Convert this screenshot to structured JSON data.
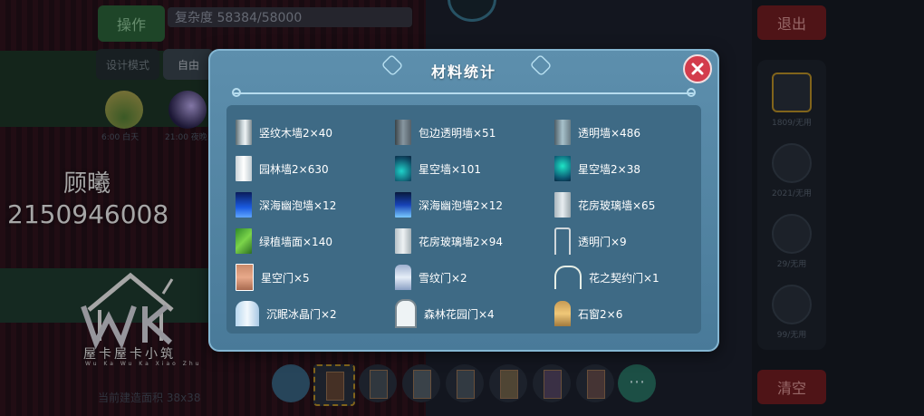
{
  "background": {
    "ops_label": "操作",
    "complexity": "复杂度 58384/58000",
    "design_mode_label": "设计模式",
    "free_label": "自由",
    "time_labels": [
      "6:00 白天",
      "21:00 夜晚"
    ],
    "exit_label": "退出",
    "clear_label": "清空",
    "right_panel_counts": [
      "1809/无用",
      "2021/无用",
      "29/无用",
      "99/无用"
    ],
    "build_area_label": "当前建造面积 38x38"
  },
  "watermark": {
    "name": "顾曦",
    "id": "2150946008",
    "brand": "屋卡屋卡小筑",
    "brand_sub": "Wu Ka Wu Ka Xiao Zhu"
  },
  "modal": {
    "title": "材料统计",
    "close_icon": "close-icon",
    "materials": [
      {
        "label": "竖纹木墙2×40",
        "icon": "ic-woodwall"
      },
      {
        "label": "包边透明墙×51",
        "icon": "ic-edgeglass"
      },
      {
        "label": "透明墙×486",
        "icon": "ic-clearwall"
      },
      {
        "label": "园林墙2×630",
        "icon": "ic-garden"
      },
      {
        "label": "星空墙×101",
        "icon": "ic-star"
      },
      {
        "label": "星空墙2×38",
        "icon": "ic-star2"
      },
      {
        "label": "深海幽泡墙×12",
        "icon": "ic-bubble"
      },
      {
        "label": "深海幽泡墙2×12",
        "icon": "ic-bubble2"
      },
      {
        "label": "花房玻璃墙×65",
        "icon": "ic-flowerglass"
      },
      {
        "label": "绿植墙面×140",
        "icon": "ic-green"
      },
      {
        "label": "花房玻璃墙2×94",
        "icon": "ic-flowerglass2"
      },
      {
        "label": "透明门×9",
        "icon": "ic-cleardoor"
      },
      {
        "label": "星空门×5",
        "icon": "ic-stardoor"
      },
      {
        "label": "雪纹门×2",
        "icon": "ic-snowdoor"
      },
      {
        "label": "花之契约门×1",
        "icon": "ic-pactdoor"
      },
      {
        "label": "沉眠冰晶门×2",
        "icon": "ic-icedoor"
      },
      {
        "label": "森林花园门×4",
        "icon": "ic-forestdoor"
      },
      {
        "label": "石窗2×6",
        "icon": "ic-stonewin"
      }
    ]
  }
}
